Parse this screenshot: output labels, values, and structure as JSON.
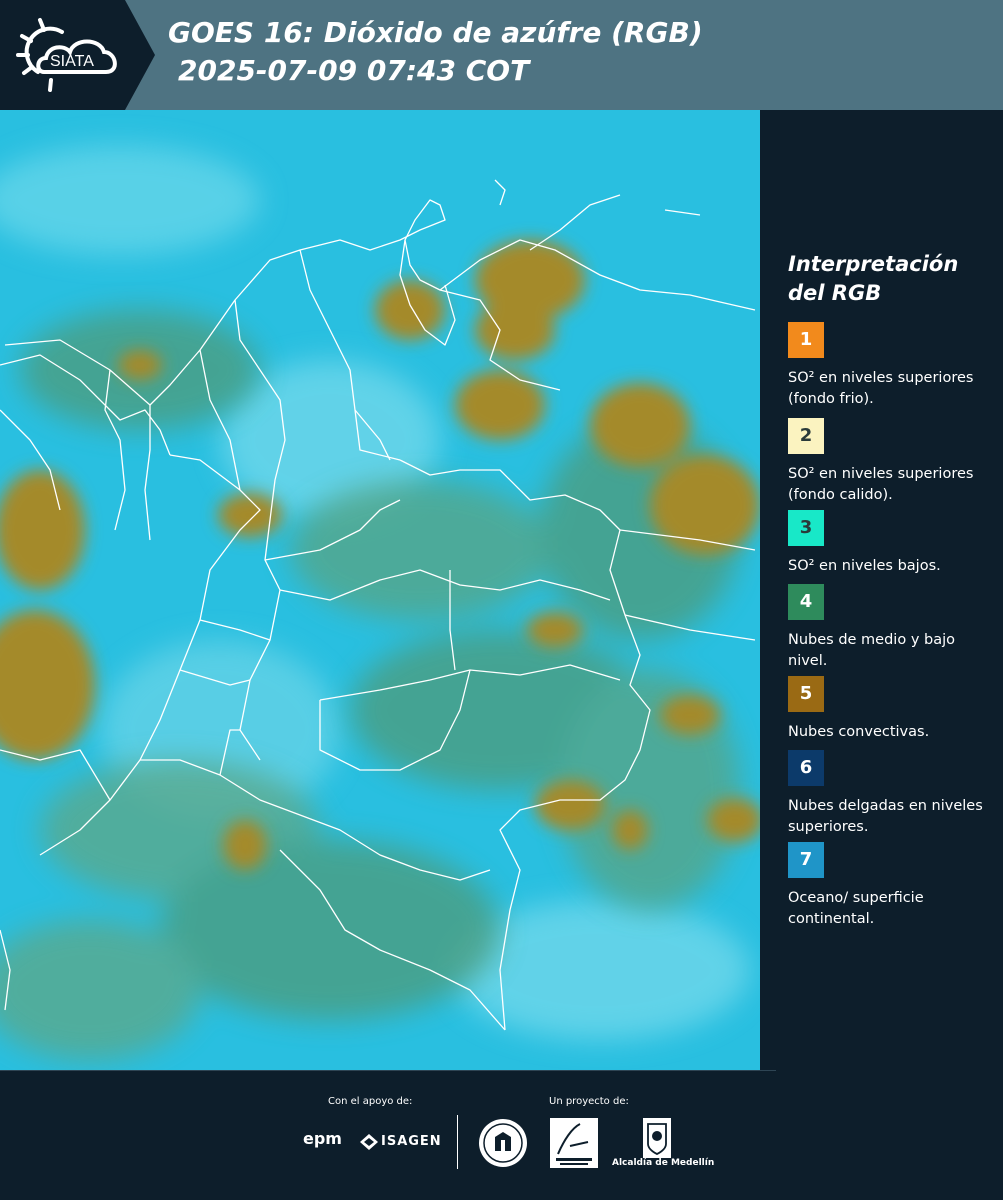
{
  "header": {
    "logo_text": "SIATA",
    "title_line1": "GOES 16: Dióxido de azúfre (RGB)",
    "title_line2": "2025-07-09 07:43 COT"
  },
  "legend": {
    "title_line1": "Interpretación",
    "title_line2": "del RGB",
    "items": [
      {
        "num": "1",
        "color": "#f28a1c",
        "text": "SO² en niveles superiores (fondo frio)."
      },
      {
        "num": "2",
        "color": "#fbf3c0",
        "text": "SO² en niveles superiores (fondo calido)."
      },
      {
        "num": "3",
        "color": "#18e8c8",
        "text": "SO² en niveles bajos."
      },
      {
        "num": "4",
        "color": "#2e8b5c",
        "text": "Nubes de medio y bajo nivel."
      },
      {
        "num": "5",
        "color": "#9a6a14",
        "text": "Nubes convectivas."
      },
      {
        "num": "6",
        "color": "#0c3a6a",
        "text": "Nubes delgadas en niveles superiores."
      },
      {
        "num": "7",
        "color": "#1f95c8",
        "text": "Oceano/ superficie continental."
      }
    ]
  },
  "footer": {
    "support_label": "Con el apoyo de:",
    "project_label": "Un proyecto de:",
    "sponsor1": "epm",
    "sponsor2": "ISAGEN",
    "partner_alcaldia": "Alcaldía de Medellín"
  },
  "map_colors": {
    "background": "#29bfe0",
    "convective": "#a48a2a",
    "mid_low": "#4c9d80",
    "borders": "#ffffff"
  }
}
